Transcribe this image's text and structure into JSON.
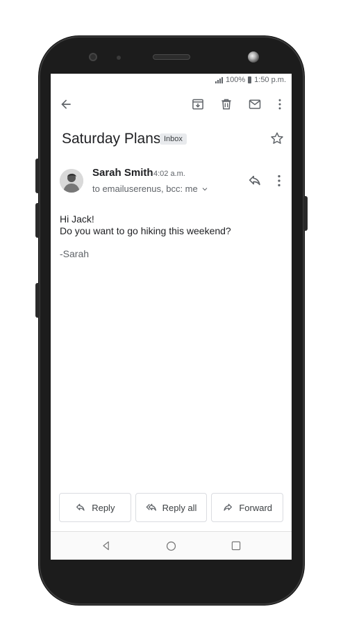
{
  "status_bar": {
    "battery": "100%",
    "time": "1:50 p.m."
  },
  "toolbar": {
    "back_icon": "arrow-left-icon",
    "archive_icon": "archive-icon",
    "delete_icon": "trash-icon",
    "mark_unread_icon": "mail-icon",
    "more_icon": "more-vert-icon"
  },
  "email": {
    "subject": "Saturday Plans",
    "label": "Inbox",
    "sender_name": "Sarah Smith",
    "time": "4:02 a.m.",
    "recipients": "to emailuserenus, bcc: me",
    "body_lines": [
      "Hi Jack!",
      "Do you want to go hiking this weekend?"
    ],
    "signature": "-Sarah"
  },
  "actions": {
    "reply": "Reply",
    "reply_all": "Reply all",
    "forward": "Forward"
  },
  "colors": {
    "text_primary": "#202124",
    "text_secondary": "#5f6368",
    "border": "#dadce0"
  }
}
